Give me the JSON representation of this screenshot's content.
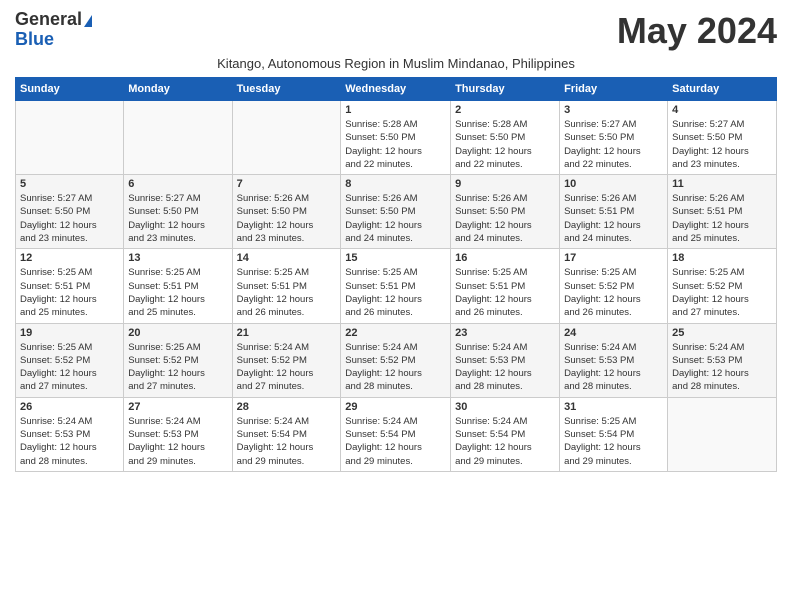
{
  "logo": {
    "general": "General",
    "blue": "Blue"
  },
  "title": "May 2024",
  "subtitle": "Kitango, Autonomous Region in Muslim Mindanao, Philippines",
  "days_of_week": [
    "Sunday",
    "Monday",
    "Tuesday",
    "Wednesday",
    "Thursday",
    "Friday",
    "Saturday"
  ],
  "weeks": [
    [
      {
        "day": "",
        "info": ""
      },
      {
        "day": "",
        "info": ""
      },
      {
        "day": "",
        "info": ""
      },
      {
        "day": "1",
        "info": "Sunrise: 5:28 AM\nSunset: 5:50 PM\nDaylight: 12 hours\nand 22 minutes."
      },
      {
        "day": "2",
        "info": "Sunrise: 5:28 AM\nSunset: 5:50 PM\nDaylight: 12 hours\nand 22 minutes."
      },
      {
        "day": "3",
        "info": "Sunrise: 5:27 AM\nSunset: 5:50 PM\nDaylight: 12 hours\nand 22 minutes."
      },
      {
        "day": "4",
        "info": "Sunrise: 5:27 AM\nSunset: 5:50 PM\nDaylight: 12 hours\nand 23 minutes."
      }
    ],
    [
      {
        "day": "5",
        "info": "Sunrise: 5:27 AM\nSunset: 5:50 PM\nDaylight: 12 hours\nand 23 minutes."
      },
      {
        "day": "6",
        "info": "Sunrise: 5:27 AM\nSunset: 5:50 PM\nDaylight: 12 hours\nand 23 minutes."
      },
      {
        "day": "7",
        "info": "Sunrise: 5:26 AM\nSunset: 5:50 PM\nDaylight: 12 hours\nand 23 minutes."
      },
      {
        "day": "8",
        "info": "Sunrise: 5:26 AM\nSunset: 5:50 PM\nDaylight: 12 hours\nand 24 minutes."
      },
      {
        "day": "9",
        "info": "Sunrise: 5:26 AM\nSunset: 5:50 PM\nDaylight: 12 hours\nand 24 minutes."
      },
      {
        "day": "10",
        "info": "Sunrise: 5:26 AM\nSunset: 5:51 PM\nDaylight: 12 hours\nand 24 minutes."
      },
      {
        "day": "11",
        "info": "Sunrise: 5:26 AM\nSunset: 5:51 PM\nDaylight: 12 hours\nand 25 minutes."
      }
    ],
    [
      {
        "day": "12",
        "info": "Sunrise: 5:25 AM\nSunset: 5:51 PM\nDaylight: 12 hours\nand 25 minutes."
      },
      {
        "day": "13",
        "info": "Sunrise: 5:25 AM\nSunset: 5:51 PM\nDaylight: 12 hours\nand 25 minutes."
      },
      {
        "day": "14",
        "info": "Sunrise: 5:25 AM\nSunset: 5:51 PM\nDaylight: 12 hours\nand 26 minutes."
      },
      {
        "day": "15",
        "info": "Sunrise: 5:25 AM\nSunset: 5:51 PM\nDaylight: 12 hours\nand 26 minutes."
      },
      {
        "day": "16",
        "info": "Sunrise: 5:25 AM\nSunset: 5:51 PM\nDaylight: 12 hours\nand 26 minutes."
      },
      {
        "day": "17",
        "info": "Sunrise: 5:25 AM\nSunset: 5:52 PM\nDaylight: 12 hours\nand 26 minutes."
      },
      {
        "day": "18",
        "info": "Sunrise: 5:25 AM\nSunset: 5:52 PM\nDaylight: 12 hours\nand 27 minutes."
      }
    ],
    [
      {
        "day": "19",
        "info": "Sunrise: 5:25 AM\nSunset: 5:52 PM\nDaylight: 12 hours\nand 27 minutes."
      },
      {
        "day": "20",
        "info": "Sunrise: 5:25 AM\nSunset: 5:52 PM\nDaylight: 12 hours\nand 27 minutes."
      },
      {
        "day": "21",
        "info": "Sunrise: 5:24 AM\nSunset: 5:52 PM\nDaylight: 12 hours\nand 27 minutes."
      },
      {
        "day": "22",
        "info": "Sunrise: 5:24 AM\nSunset: 5:52 PM\nDaylight: 12 hours\nand 28 minutes."
      },
      {
        "day": "23",
        "info": "Sunrise: 5:24 AM\nSunset: 5:53 PM\nDaylight: 12 hours\nand 28 minutes."
      },
      {
        "day": "24",
        "info": "Sunrise: 5:24 AM\nSunset: 5:53 PM\nDaylight: 12 hours\nand 28 minutes."
      },
      {
        "day": "25",
        "info": "Sunrise: 5:24 AM\nSunset: 5:53 PM\nDaylight: 12 hours\nand 28 minutes."
      }
    ],
    [
      {
        "day": "26",
        "info": "Sunrise: 5:24 AM\nSunset: 5:53 PM\nDaylight: 12 hours\nand 28 minutes."
      },
      {
        "day": "27",
        "info": "Sunrise: 5:24 AM\nSunset: 5:53 PM\nDaylight: 12 hours\nand 29 minutes."
      },
      {
        "day": "28",
        "info": "Sunrise: 5:24 AM\nSunset: 5:54 PM\nDaylight: 12 hours\nand 29 minutes."
      },
      {
        "day": "29",
        "info": "Sunrise: 5:24 AM\nSunset: 5:54 PM\nDaylight: 12 hours\nand 29 minutes."
      },
      {
        "day": "30",
        "info": "Sunrise: 5:24 AM\nSunset: 5:54 PM\nDaylight: 12 hours\nand 29 minutes."
      },
      {
        "day": "31",
        "info": "Sunrise: 5:25 AM\nSunset: 5:54 PM\nDaylight: 12 hours\nand 29 minutes."
      },
      {
        "day": "",
        "info": ""
      }
    ]
  ]
}
